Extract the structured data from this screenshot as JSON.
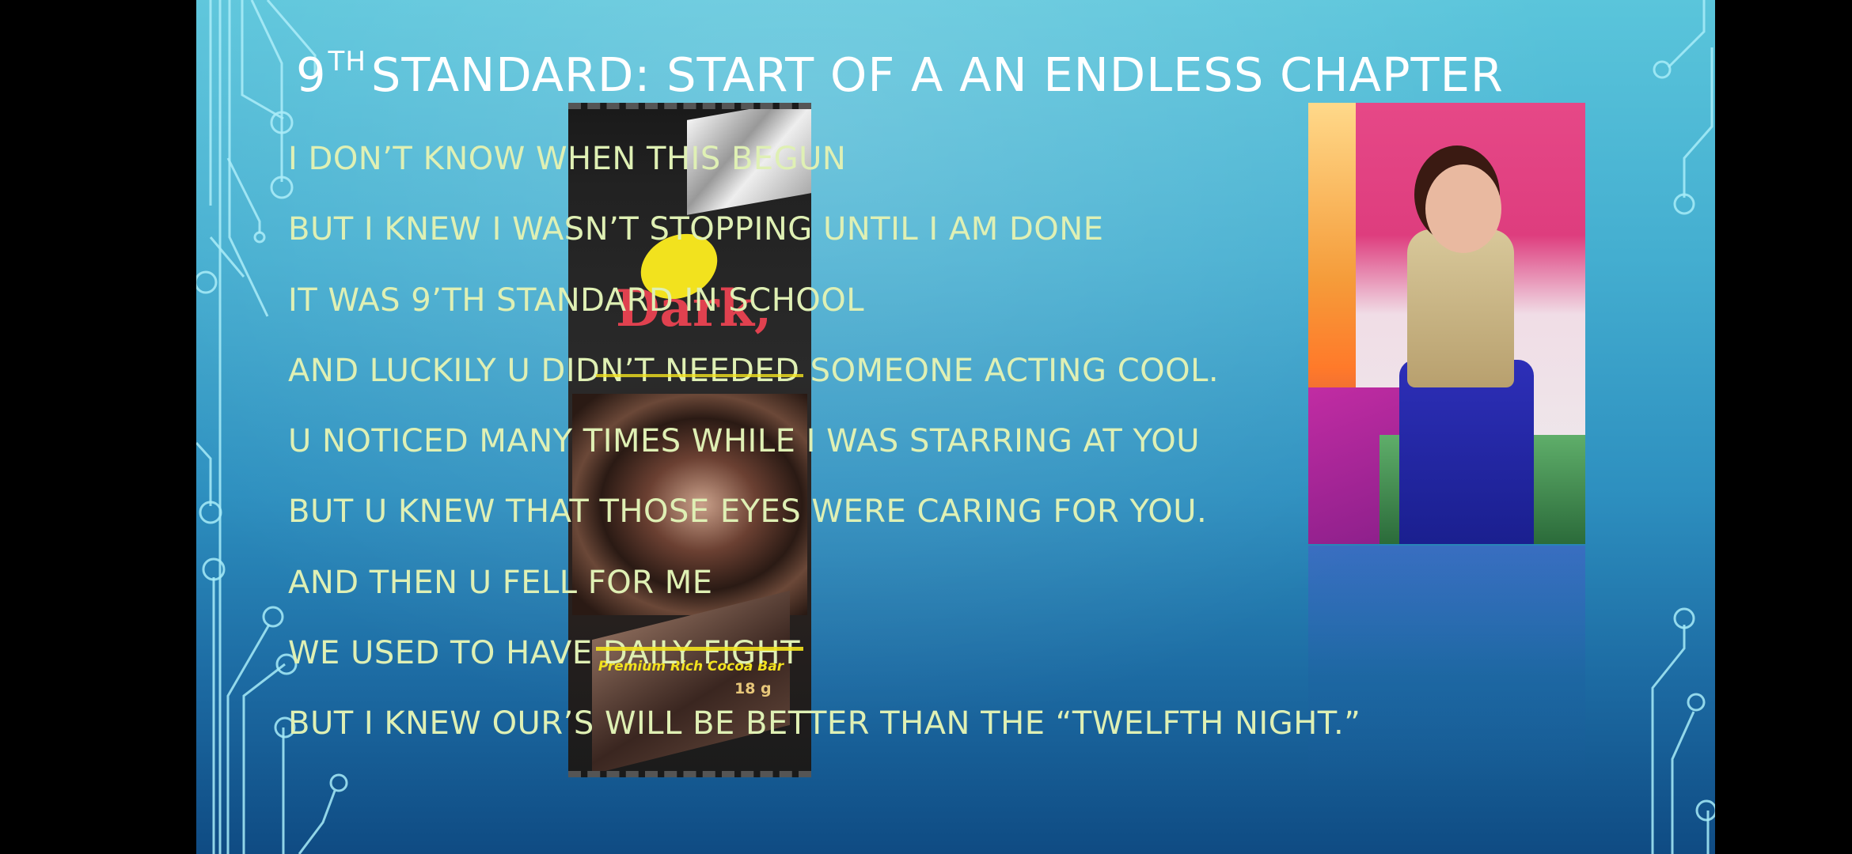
{
  "slide": {
    "title_prefix": "9",
    "title_sup": "TH",
    "title_rest": "STANDARD: START OF A AN ENDLESS CHAPTER",
    "lines": [
      "I DON’T KNOW WHEN THIS BEGUN",
      "BUT I KNEW I WASN’T STOPPING UNTIL I AM DONE",
      "IT WAS 9’TH STANDARD IN SCHOOL",
      "AND LUCKILY U DIDN’T NEEDED SOMEONE ACTING COOL.",
      "U NOTICED MANY TIMES WHILE I WAS STARRING AT YOU",
      "BUT U KNEW THAT THOSE EYES WERE CARING FOR YOU.",
      "AND THEN U FELL FOR ME",
      "WE USED TO HAVE DAILY FIGHT",
      "BUT I KNEW OUR’S WILL BE BETTER THAN THE “TWELFTH NIGHT.”"
    ],
    "wrapper_brand": "Dark,",
    "wrapper_tag": "Premium Rich Cocoa Bar",
    "wrapper_weight": "18 g"
  },
  "colors": {
    "text": "#dff0b4",
    "title": "#ffffff",
    "circuit": "#a8ecf8",
    "accent_yellow": "#f2e21e"
  }
}
